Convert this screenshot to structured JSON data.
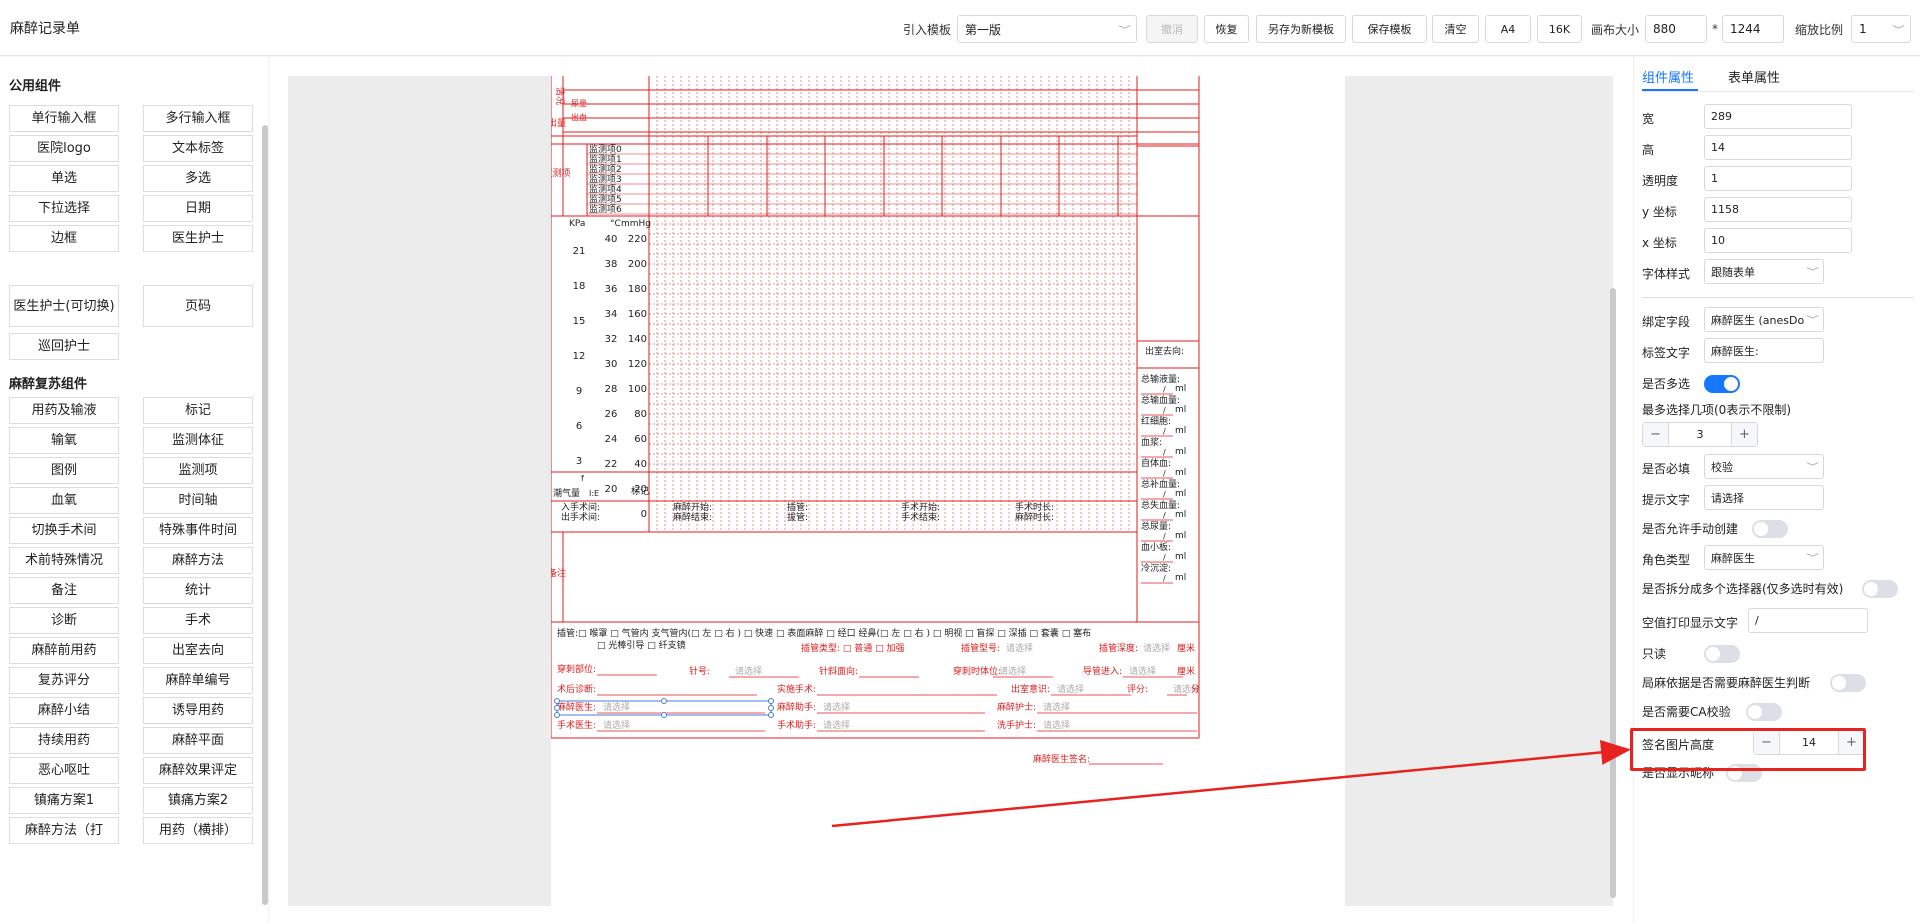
{
  "app": {
    "title": "麻醉记录单"
  },
  "toolbar": {
    "template_label": "引入模板",
    "template_value": "第一版",
    "undo": "撤消",
    "restore": "恢复",
    "save_as_new": "另存为新模板",
    "save_template": "保存模板",
    "clear": "清空",
    "a4": "A4",
    "k16": "16K",
    "canvas_size_label": "画布大小",
    "canvas_width": "880",
    "times": "*",
    "canvas_height": "1244",
    "zoom_label": "缩放比例",
    "zoom_value": "1"
  },
  "left": {
    "common_title": "公用组件",
    "common_items": [
      "单行输入框",
      "多行输入框",
      "医院logo",
      "文本标签",
      "单选",
      "多选",
      "下拉选择",
      "日期",
      "边框",
      "医生护士",
      "医生护士(可切换)",
      "页码",
      "巡回护士"
    ],
    "anes_title": "麻醉复苏组件",
    "anes_items": [
      "用药及输液",
      "标记",
      "输氧",
      "监测体征",
      "图例",
      "监测项",
      "血氧",
      "时间轴",
      "切换手术间",
      "特殊事件时间",
      "术前特殊情况",
      "麻醉方法",
      "备注",
      "统计",
      "诊断",
      "手术",
      "麻醉前用药",
      "出室去向",
      "复苏评分",
      "麻醉单编号",
      "麻醉小结",
      "诱导用药",
      "持续用药",
      "麻醉平面",
      "恶心呕吐",
      "麻醉效果评定",
      "镇痛方案1",
      "镇痛方案2",
      "麻醉方法（打",
      "用药（横排）"
    ]
  },
  "paper": {
    "side_labels": [
      "清况",
      "出量",
      "监测项",
      "备注"
    ],
    "row_labels": [
      "尿量",
      "出血"
    ],
    "monitor_items": [
      "监测项0",
      "监测项1",
      "监测项2",
      "监测项3",
      "监测项4",
      "监测项5",
      "监测项6"
    ],
    "kpa_header": "KPa",
    "temp_header": "°C",
    "mmhg_header": "mmHg",
    "kpa_values": [
      "21",
      "18",
      "15",
      "12",
      "9",
      "6",
      "3"
    ],
    "temp_values": [
      "40",
      "38",
      "36",
      "34",
      "32",
      "30",
      "28",
      "26",
      "24",
      "22",
      "20"
    ],
    "mmhg_values": [
      "220",
      "200",
      "180",
      "160",
      "140",
      "120",
      "100",
      "80",
      "60",
      "40",
      "20",
      "0"
    ],
    "tidal_label": "潮气量",
    "ie_label": "I:E",
    "f_label": "f",
    "mark_label": "标记",
    "times": [
      [
        "入手术间:",
        "出手术间:"
      ],
      [
        "麻醉开始:",
        "麻醉结束:"
      ],
      [
        "插管:",
        "拔管:"
      ],
      [
        "手术开始:",
        "手术结束:"
      ],
      [
        "手术时长:",
        "麻醉时长:"
      ]
    ],
    "outroom_title": "出室去向:",
    "stats": [
      "总输液量:",
      "总输血量:",
      "红细胞:",
      "血浆:",
      "自体血:",
      "总补血量:",
      "总失血量:",
      "总尿量:",
      "血小板:",
      "冷沉淀:"
    ],
    "ml": "ml",
    "slash": "/",
    "intub_line1": "插管:□ 喉罩 □ 气管内  支气管内(□ 左  □ 右 ) □ 快速 □ 表面麻醉 □ 经口  经鼻(□ 左  □ 右 ) □ 明视 □ 盲探 □ 深插 □ 套囊 □ 塞布",
    "intub_line2": "□ 光棒引导 □ 纤支镜",
    "tube_type": "插管类型: □ 普通  □ 加强",
    "tube_model": "插管型号:",
    "tube_depth": "插管深度:",
    "cm": "厘米",
    "placeholder": "请选择",
    "f_puncture": "穿刺部位:",
    "f_needle": "针号:",
    "f_bevel": "针斜面向:",
    "f_position": "穿刺时体位:",
    "f_catheter": "导管进入:",
    "f_postdiag": "术后诊断:",
    "f_surgery": "实施手术:",
    "f_conscious": "出室意识:",
    "f_score": "评分:",
    "f_point": "分",
    "f_anes_doc": "麻醉医生:",
    "f_anes_asst": "麻醉助手:",
    "f_anes_nurse": "麻醉护士:",
    "f_surgeon": "手术医生:",
    "f_surg_asst": "手术助手:",
    "f_wash_nurse": "洗手护士:",
    "signature": "麻醉医生签名:"
  },
  "right": {
    "tab_component": "组件属性",
    "tab_form": "表单属性",
    "width_label": "宽",
    "width": "289",
    "height_label": "高",
    "height": "14",
    "opacity_label": "透明度",
    "opacity": "1",
    "y_label": "y 坐标",
    "y": "1158",
    "x_label": "x 坐标",
    "x": "10",
    "font_label": "字体样式",
    "font": "跟随表单",
    "bind_label": "绑定字段",
    "bind": "麻醉医生 (anesDo",
    "labeltext_label": "标签文字",
    "labeltext": "麻醉医生:",
    "multi_label": "是否多选",
    "max_label": "最多选择几项(0表示不限制)",
    "max": "3",
    "required_label": "是否必填",
    "required": "校验",
    "hint_label": "提示文字",
    "hint": "请选择",
    "manual_label": "是否允许手动创建",
    "role_label": "角色类型",
    "role": "麻醉医生",
    "split_label": "是否拆分成多个选择器(仅多选时有效)",
    "empty_label": "空值打印显示文字",
    "empty": "/",
    "readonly_label": "只读",
    "local_label": "局麻依据是否需要麻醉医生判断",
    "ca_label": "是否需要CA校验",
    "sigimg_label": "签名图片高度",
    "sigimg": "14",
    "nickname_label": "是否显示昵称",
    "minus": "−",
    "plus": "+"
  },
  "colors": {
    "form_red": "#e01b1b",
    "accent": "#1677ff",
    "highlight": "#e8231f"
  }
}
